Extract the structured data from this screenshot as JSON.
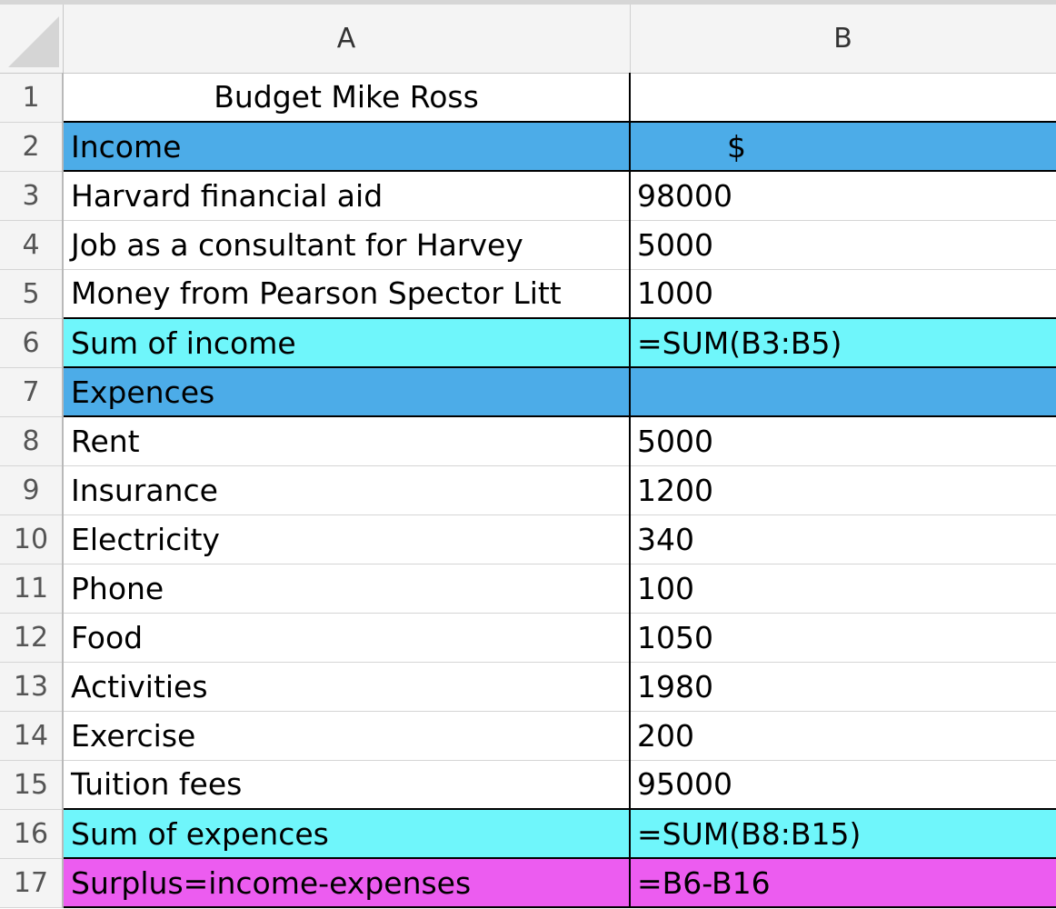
{
  "columns": [
    "A",
    "B"
  ],
  "rows": [
    {
      "num": "1",
      "a": "Budget Mike Ross",
      "b": "",
      "style": "title"
    },
    {
      "num": "2",
      "a": "Income",
      "b": "$",
      "style": "blue"
    },
    {
      "num": "3",
      "a": "Harvard financial aid",
      "b": "98000",
      "style": ""
    },
    {
      "num": "4",
      "a": "Job as a consultant for Harvey",
      "b": "5000",
      "style": ""
    },
    {
      "num": "5",
      "a": "Money from Pearson Spector Litt",
      "b": "1000",
      "style": ""
    },
    {
      "num": "6",
      "a": "Sum of income",
      "b": "=SUM(B3:B5)",
      "style": "cyan"
    },
    {
      "num": "7",
      "a": "Expences",
      "b": "",
      "style": "blue"
    },
    {
      "num": "8",
      "a": "Rent",
      "b": "5000",
      "style": ""
    },
    {
      "num": "9",
      "a": "Insurance",
      "b": "1200",
      "style": ""
    },
    {
      "num": "10",
      "a": "Electricity",
      "b": "340",
      "style": ""
    },
    {
      "num": "11",
      "a": "Phone",
      "b": "100",
      "style": ""
    },
    {
      "num": "12",
      "a": "Food",
      "b": "1050",
      "style": ""
    },
    {
      "num": "13",
      "a": "Activities",
      "b": "1980",
      "style": ""
    },
    {
      "num": "14",
      "a": "Exercise",
      "b": "200",
      "style": ""
    },
    {
      "num": "15",
      "a": "Tuition fees",
      "b": "95000",
      "style": ""
    },
    {
      "num": "16",
      "a": "Sum of expences",
      "b": "=SUM(B8:B15)",
      "style": "cyan"
    },
    {
      "num": "17",
      "a": "Surplus=income-expenses",
      "b": "=B6-B16",
      "style": "magenta"
    }
  ],
  "colors": {
    "header_blue": "#4cace8",
    "sum_cyan": "#6ff6fb",
    "surplus_magenta": "#ec5cf0"
  }
}
